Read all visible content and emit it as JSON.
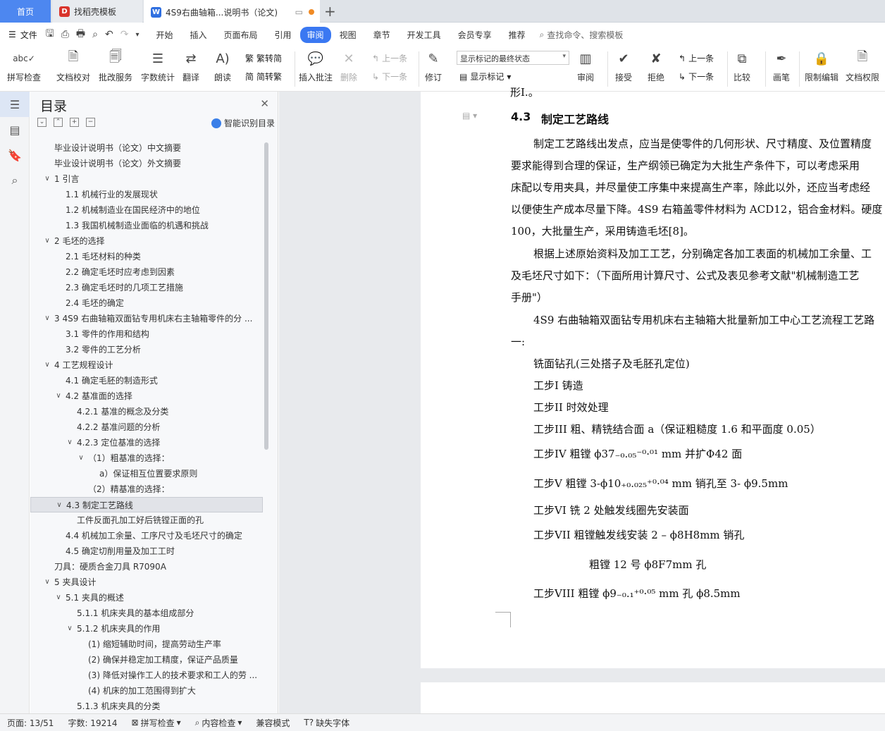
{
  "tabs": {
    "home": "首页",
    "template": "找稻壳模板",
    "document": "4S9右曲轴箱...说明书（论文)"
  },
  "menu": {
    "file": "文件",
    "items": [
      "开始",
      "插入",
      "页面布局",
      "引用",
      "审阅",
      "视图",
      "章节",
      "开发工具",
      "会员专享",
      "推荐"
    ],
    "active": "审阅",
    "search": "查找命令、搜索模板"
  },
  "ribbon": {
    "spellcheck": "拼写检查",
    "doc_proof": "文档校对",
    "batch_service": "批改服务",
    "word_count": "字数统计",
    "translate": "翻译",
    "read_aloud": "朗读",
    "simp_to_trad": "繁转简",
    "trad_to_simp": "简转繁",
    "insert_comment": "插入批注",
    "delete": "删除",
    "prev_comment": "上一条",
    "next_comment": "下一条",
    "revise": "修订",
    "mark_state": "显示标记的最终状态",
    "show_marks": "显示标记",
    "review": "审阅",
    "accept": "接受",
    "reject": "拒绝",
    "prev_change": "上一条",
    "next_change": "下一条",
    "compare": "比较",
    "pen": "画笔",
    "restrict_edit": "限制编辑",
    "doc_permission": "文档权限"
  },
  "toc": {
    "title": "目录",
    "smart": "智能识别目录",
    "items": [
      {
        "text": "毕业设计说明书（论文）中文摘要",
        "level": 0,
        "caret": ""
      },
      {
        "text": "毕业设计说明书（论文）外文摘要",
        "level": 0,
        "caret": ""
      },
      {
        "text": "1   引言",
        "level": 0,
        "caret": "v"
      },
      {
        "text": "1.1   机械行业的发展现状",
        "level": 1,
        "caret": ""
      },
      {
        "text": "1.2   机械制造业在国民经济中的地位",
        "level": 1,
        "caret": ""
      },
      {
        "text": "1.3   我国机械制造业面临的机遇和挑战",
        "level": 1,
        "caret": ""
      },
      {
        "text": "2   毛坯的选择",
        "level": 0,
        "caret": "v"
      },
      {
        "text": "2.1   毛坯材料的种类",
        "level": 1,
        "caret": ""
      },
      {
        "text": "2.2   确定毛坯时应考虑到因素",
        "level": 1,
        "caret": ""
      },
      {
        "text": "2.3   确定毛坯时的几项工艺措施",
        "level": 1,
        "caret": ""
      },
      {
        "text": "2.4   毛坯的确定",
        "level": 1,
        "caret": ""
      },
      {
        "text": "3   4S9 右曲轴箱双面钻专用机床右主轴箱零件的分 ...",
        "level": 0,
        "caret": "v"
      },
      {
        "text": "3.1   零件的作用和结构",
        "level": 1,
        "caret": ""
      },
      {
        "text": "3.2   零件的工艺分析",
        "level": 1,
        "caret": ""
      },
      {
        "text": "4   工艺规程设计",
        "level": 0,
        "caret": "v"
      },
      {
        "text": "4.1   确定毛胚的制造形式",
        "level": 1,
        "caret": ""
      },
      {
        "text": "4.2   基准面的选择",
        "level": 1,
        "caret": "v"
      },
      {
        "text": "4.2.1   基准的概念及分类",
        "level": 2,
        "caret": ""
      },
      {
        "text": "4.2.2   基准问题的分析",
        "level": 2,
        "caret": ""
      },
      {
        "text": "4.2.3   定位基准的选择",
        "level": 2,
        "caret": "v"
      },
      {
        "text": "（1）粗基准的选择：",
        "level": 3,
        "caret": "v"
      },
      {
        "text": "a）保证相互位置要求原则",
        "level": 4,
        "caret": ""
      },
      {
        "text": "（2）精基准的选择：",
        "level": 3,
        "caret": ""
      },
      {
        "text": "4.3   制定工艺路线",
        "level": 1,
        "caret": "v",
        "selected": true
      },
      {
        "text": "工件反面孔加工好后铣镗正面的孔",
        "level": 2,
        "caret": ""
      },
      {
        "text": "4.4   机械加工余量、工序尺寸及毛坯尺寸的确定",
        "level": 1,
        "caret": ""
      },
      {
        "text": "4.5   确定切削用量及加工工时",
        "level": 1,
        "caret": ""
      },
      {
        "text": "刀具：硬质合金刀具  R7090A",
        "level": 0,
        "caret": ""
      },
      {
        "text": "5   夹具设计",
        "level": 0,
        "caret": "v"
      },
      {
        "text": "5.1   夹具的概述",
        "level": 1,
        "caret": "v"
      },
      {
        "text": "5.1.1   机床夹具的基本组成部分",
        "level": 2,
        "caret": ""
      },
      {
        "text": "5.1.2   机床夹具的作用",
        "level": 2,
        "caret": "v"
      },
      {
        "text": "(1) 缩短辅助时间，提高劳动生产率",
        "level": 3,
        "caret": ""
      },
      {
        "text": "(2) 确保并稳定加工精度，保证产品质量",
        "level": 3,
        "caret": ""
      },
      {
        "text": "(3) 降低对操作工人的技术要求和工人的劳 ...",
        "level": 3,
        "caret": ""
      },
      {
        "text": "(4) 机床的加工范围得到扩大",
        "level": 3,
        "caret": ""
      },
      {
        "text": "5.1.3   机床夹具的分类",
        "level": 2,
        "caret": ""
      }
    ]
  },
  "document": {
    "top_fragment": "形I.。",
    "heading_num": "4.3",
    "heading_text": "制定工艺路线",
    "p1": [
      "制定工艺路线出发点，应当是使零件的几何形状、尺寸精度、及位置精度",
      "要求能得到合理的保证，生产纲领已确定为大批生产条件下，可以考虑采用",
      "床配以专用夹具，并尽量使工序集中来提高生产率，除此以外，还应当考虑经",
      "以便使生产成本尽量下降。4S9 右箱盖零件材料为 ACD12，铝合金材料。硬度",
      "100，大批量生产，采用铸造毛坯[8]。"
    ],
    "p2": [
      "根据上述原始资料及加工工艺，分别确定各加工表面的机械加工余量、工",
      "及毛坯尺寸如下：（下面所用计算尺寸、公式及表见参考文献\"机械制造工艺",
      "手册\"）"
    ],
    "p3": [
      "4S9 右曲轴箱双面钻专用机床右主轴箱大批量新加工中心工艺流程工艺路",
      "一:"
    ],
    "steps": [
      "铣面钻孔(三处搭子及毛胚孔定位)",
      "工步I       铸造",
      "工步II       时效处理",
      "工步III      粗、精铣结合面 a（保证粗糙度 1.6 和平面度 0.05）",
      "工步IV       粗镗 ϕ37₋₀.₀₅⁻⁰·⁰¹ mm 并扩Φ42 面",
      "工步V       粗镗 3-ϕ10₊₀.₀₂₅⁺⁰·⁰⁴ mm 销孔至 3-  ϕ9.5mm",
      "工步VI       铣 2 处触发线圈先安装面",
      "工步VII       粗镗触发线安装 2 – ϕ8H8mm 销孔",
      "粗镗 12 号 ϕ8F7mm 孔",
      "工步VIII       粗镗 ϕ9₋₀.₁⁺⁰·⁰⁵ mm 孔 ϕ8.5mm"
    ]
  },
  "status": {
    "page": "页面: 13/51",
    "words": "字数: 19214",
    "spell": "拼写检查",
    "content": "内容检查",
    "compat": "兼容模式",
    "fonts": "缺失字体"
  },
  "colors": {
    "accent": "#3a78f2",
    "home_tab": "#4d87f0"
  }
}
